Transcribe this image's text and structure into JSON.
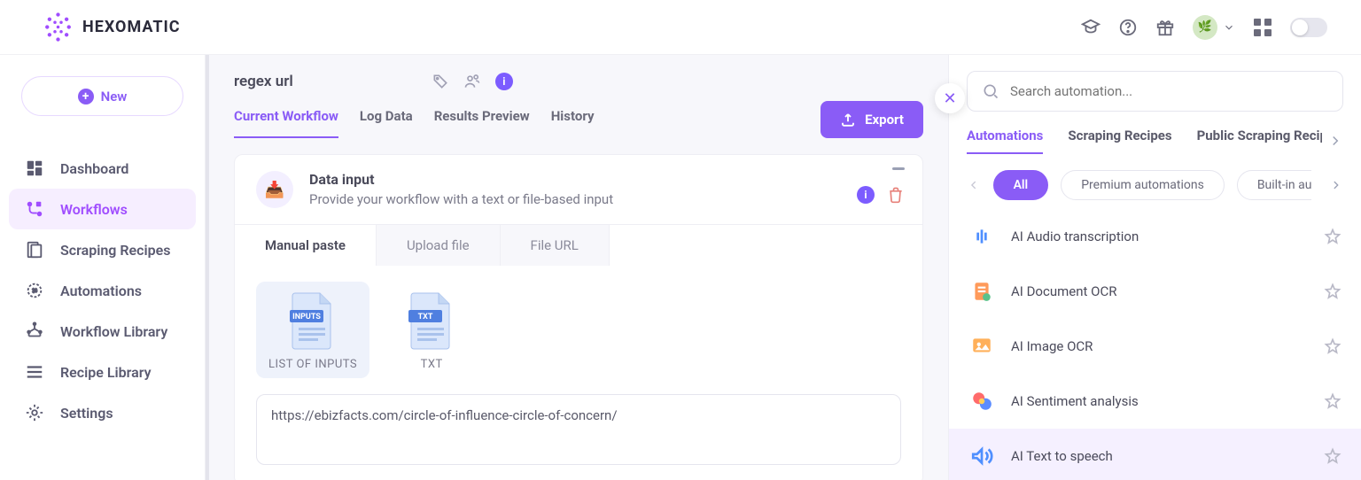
{
  "header": {
    "brand": "HEXOMATIC"
  },
  "sidebar": {
    "new_label": "New",
    "items": [
      {
        "label": "Dashboard",
        "icon": "dashboard"
      },
      {
        "label": "Workflows",
        "icon": "workflows",
        "active": true
      },
      {
        "label": "Scraping Recipes",
        "icon": "recipes"
      },
      {
        "label": "Automations",
        "icon": "automations"
      },
      {
        "label": "Workflow Library",
        "icon": "wf-lib"
      },
      {
        "label": "Recipe Library",
        "icon": "rec-lib"
      },
      {
        "label": "Settings",
        "icon": "settings"
      }
    ]
  },
  "workflow": {
    "title": "regex url",
    "tabs": [
      {
        "label": "Current Workflow",
        "active": true
      },
      {
        "label": "Log Data"
      },
      {
        "label": "Results Preview"
      },
      {
        "label": "History"
      }
    ],
    "export_label": "Export",
    "step": {
      "title": "Data input",
      "desc": "Provide your workflow with a text or file-based input",
      "inner_tabs": [
        {
          "label": "Manual paste",
          "active": true
        },
        {
          "label": "Upload file"
        },
        {
          "label": "File URL"
        }
      ],
      "file_choices": [
        {
          "label": "LIST OF INPUTS",
          "badge": "INPUTS",
          "active": true
        },
        {
          "label": "TXT",
          "badge": "TXT"
        }
      ],
      "url_value": "https://ebizfacts.com/circle-of-influence-circle-of-concern/"
    }
  },
  "panel": {
    "search_placeholder": "Search automation...",
    "cat_tabs": [
      {
        "label": "Automations",
        "active": true
      },
      {
        "label": "Scraping Recipes"
      },
      {
        "label": "Public Scraping Recipes"
      }
    ],
    "pills": [
      {
        "label": "All",
        "active": true
      },
      {
        "label": "Premium automations"
      },
      {
        "label": "Built-in automo"
      }
    ],
    "automations": [
      {
        "label": "AI Audio transcription",
        "icon": "audio"
      },
      {
        "label": "AI Document OCR",
        "icon": "doc"
      },
      {
        "label": "AI Image OCR",
        "icon": "img"
      },
      {
        "label": "AI Sentiment analysis",
        "icon": "sentiment"
      },
      {
        "label": "AI Text to speech",
        "icon": "tts",
        "hovered": true
      }
    ]
  }
}
